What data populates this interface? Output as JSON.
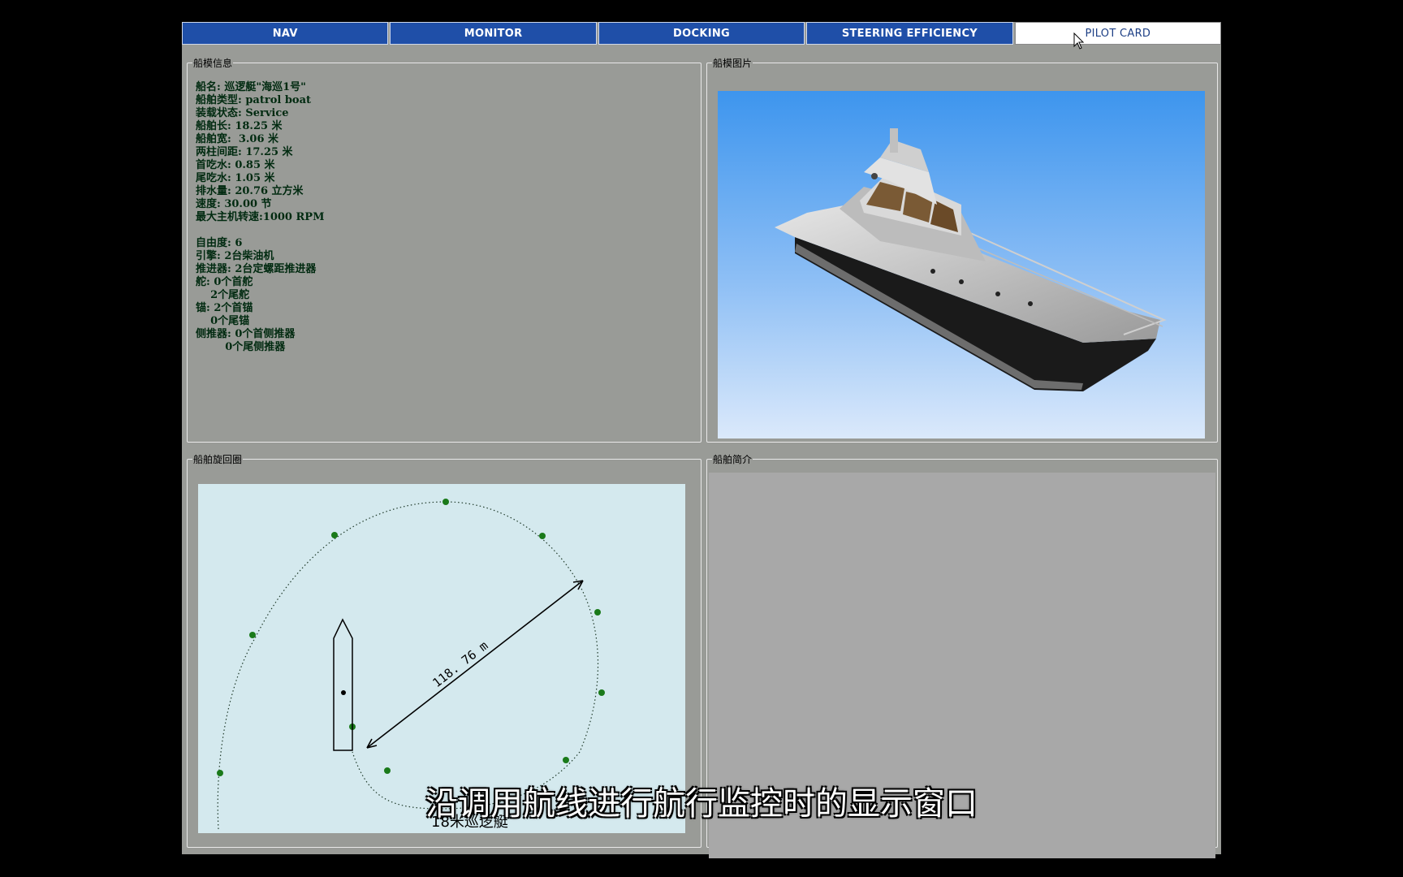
{
  "tabs": [
    {
      "label": "NAV",
      "active": false
    },
    {
      "label": "MONITOR",
      "active": false
    },
    {
      "label": "DOCKING",
      "active": false
    },
    {
      "label": "STEERING EFFICIENCY",
      "active": false
    },
    {
      "label": "PILOT CARD",
      "active": true
    }
  ],
  "panels": {
    "info_title": "船模信息",
    "picture_title": "船模图片",
    "turning_title": "船舶旋回圈",
    "description_title": "船舶简介"
  },
  "ship_info": [
    "船名: 巡逻艇\"海巡1号\"",
    "船舶类型: patrol boat",
    "装载状态: Service",
    "船舶长: 18.25 米",
    "船舶宽:  3.06 米",
    "两柱间距: 17.25 米",
    "首吃水: 0.85 米",
    "尾吃水: 1.05 米",
    "排水量: 20.76 立方米",
    "速度: 30.00 节",
    "最大主机转速:1000 RPM",
    "",
    "自由度: 6",
    "引擎: 2台柴油机",
    "推进器: 2台定螺距推进器",
    "舵: 0个首舵",
    "    2个尾舵",
    "锚: 2个首锚",
    "    0个尾锚",
    "侧推器: 0个首侧推器",
    "        0个尾侧推器"
  ],
  "turning_circle": {
    "diameter_label": "118. 76 m",
    "caption": "18米巡逻艇"
  },
  "subtitle": "沿调用航线进行航行监控时的显示窗口",
  "colors": {
    "tab_blue": "#1f4fa8",
    "panel_gray": "#999b97",
    "plot_bg": "#d4e9ee",
    "track_point": "#1a7a1a"
  }
}
